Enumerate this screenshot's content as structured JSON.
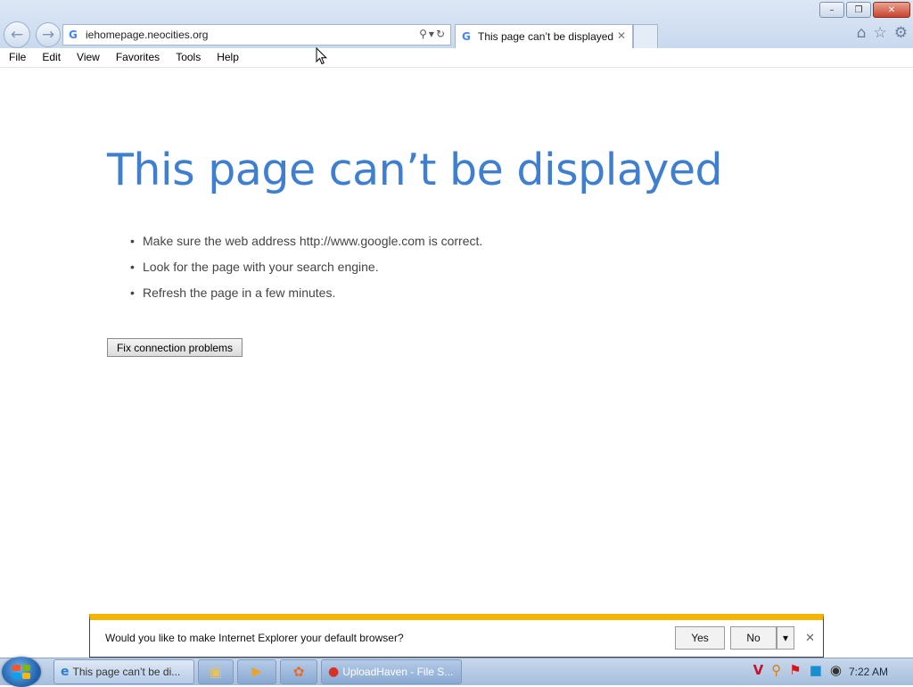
{
  "browser": {
    "address_url": "iehomepage.neocities.org",
    "tab_title": "This page can’t be displayed",
    "tab_close_glyph": "✕",
    "icons": [
      "back-icon",
      "forward-icon",
      "search-icon",
      "refresh-icon",
      "home-icon",
      "favorites-star-icon",
      "gear-icon"
    ]
  },
  "window_controls": {
    "minimize": "–",
    "restore": "❐",
    "close": "✕"
  },
  "menu": [
    "File",
    "Edit",
    "View",
    "Favorites",
    "Tools",
    "Help"
  ],
  "error_page": {
    "title": "This page can’t be displayed",
    "bullets": [
      "Make sure the web address http://www.google.com is correct.",
      "Look for the page with your search engine.",
      "Refresh the page in a few minutes."
    ],
    "bullet_glyph": "•",
    "button_label": "Fix connection problems"
  },
  "notification": {
    "message": "Would you like to make Internet Explorer your default browser?",
    "yes_label": "Yes",
    "no_label": "No",
    "dropdown_glyph": "▾",
    "close_glyph": "✕"
  },
  "taskbar": {
    "items": [
      {
        "label": "This page can’t be di...",
        "icon": "ie-icon",
        "active": true
      },
      {
        "label": "",
        "icon": "folder-icon"
      },
      {
        "label": "",
        "icon": "media-player-icon"
      },
      {
        "label": "",
        "icon": "app-icon"
      },
      {
        "label": "UploadHaven - File S...",
        "icon": "chrome-icon"
      }
    ],
    "tray_icons": [
      "v-icon",
      "search-tray-icon",
      "flag-icon",
      "display-icon",
      "camera-icon"
    ],
    "clock": "7:22 AM"
  },
  "colors": {
    "error_title": "#3f7fcf",
    "notification_bar": "#f5b400",
    "taskbar": "#a6bedc"
  }
}
